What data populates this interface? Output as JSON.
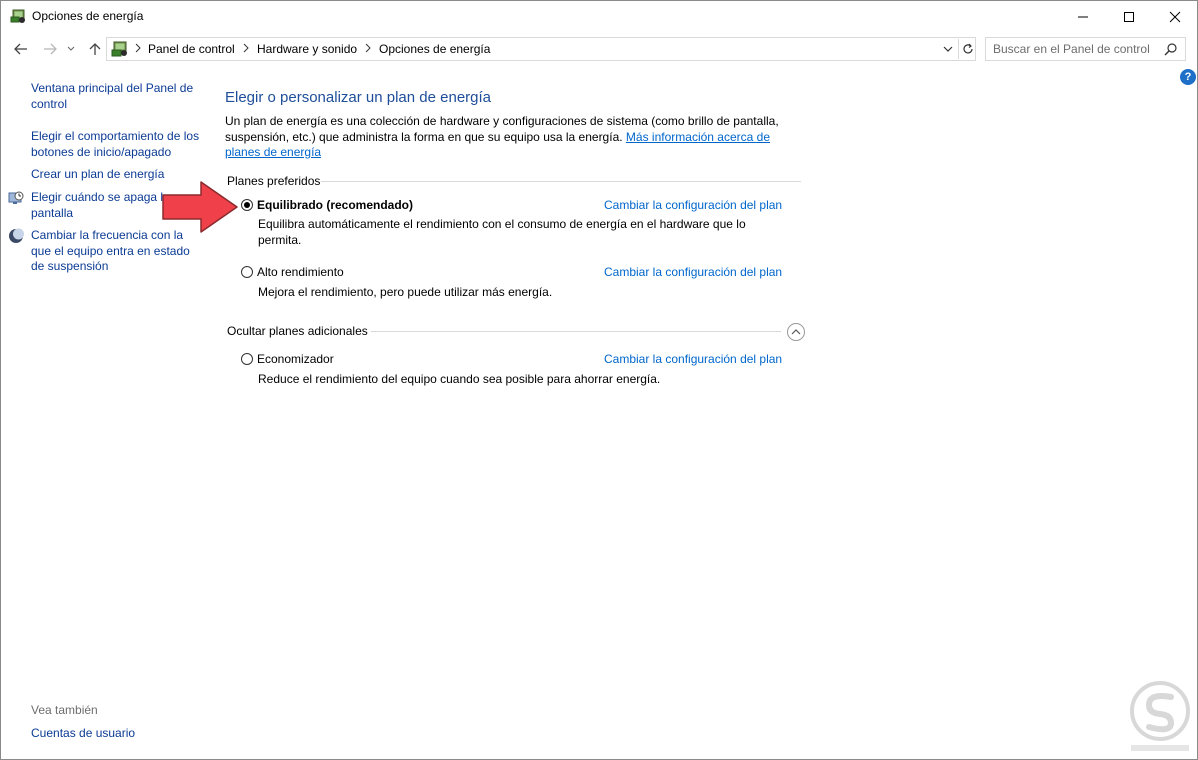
{
  "window": {
    "title": "Opciones de energía"
  },
  "nav": {
    "breadcrumbs": [
      "Panel de control",
      "Hardware y sonido",
      "Opciones de energía"
    ],
    "search_placeholder": "Buscar en el Panel de control"
  },
  "help": {
    "label": "?"
  },
  "sidebar": {
    "links": [
      {
        "label": "Ventana principal del Panel de control",
        "icon": ""
      },
      {
        "label": "Elegir el comportamiento de los botones de inicio/apagado",
        "icon": ""
      },
      {
        "label": "Crear un plan de energía",
        "icon": ""
      },
      {
        "label": "Elegir cuándo se apaga la pantalla",
        "icon": "display-clock-icon"
      },
      {
        "label": "Cambiar la frecuencia con la que el equipo entra en estado de suspensión",
        "icon": "moon-icon"
      }
    ],
    "see_also": "Vea también",
    "user_accounts": "Cuentas de usuario"
  },
  "main": {
    "title": "Elegir o personalizar un plan de energía",
    "intro": "Un plan de energía es una colección de hardware y configuraciones de sistema (como brillo de pantalla, suspensión, etc.) que administra la forma en que su equipo usa la energía.",
    "intro_link": "Más información acerca de planes de energía",
    "preferred_header": "Planes preferidos",
    "additional_header": "Ocultar planes adicionales",
    "plans": [
      {
        "name": "Equilibrado (recomendado)",
        "selected": true,
        "description": "Equilibra automáticamente el rendimiento con el consumo de energía en el hardware que lo permita.",
        "link": "Cambiar la configuración del plan"
      },
      {
        "name": "Alto rendimiento",
        "selected": false,
        "description": "Mejora el rendimiento, pero puede utilizar más energía.",
        "link": "Cambiar la configuración del plan"
      },
      {
        "name": "Economizador",
        "selected": false,
        "description": "Reduce el rendimiento del equipo cuando sea posible para ahorrar energía.",
        "link": "Cambiar la configuración del plan"
      }
    ]
  },
  "colors": {
    "link": "#0066cc",
    "title": "#1e4e9a",
    "annotation_arrow": "#f0414a"
  }
}
